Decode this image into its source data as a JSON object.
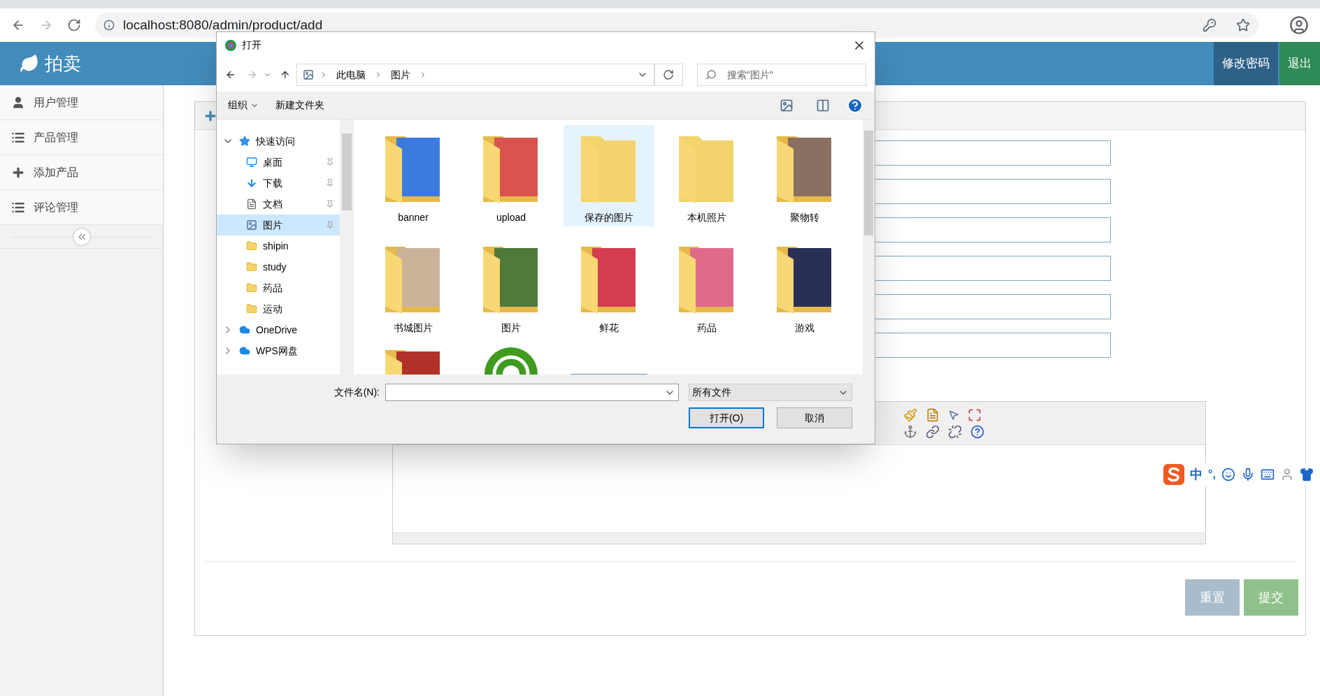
{
  "browser": {
    "url": "localhost:8080/admin/product/add"
  },
  "header": {
    "logo": "拍卖",
    "buttons": [
      {
        "label": "修改密码",
        "kind": "password"
      },
      {
        "label": "退出",
        "kind": "logout"
      }
    ]
  },
  "sidebar": {
    "items": [
      {
        "label": "用户管理",
        "kind": "user"
      },
      {
        "label": "产品管理",
        "kind": "list"
      },
      {
        "label": "添加产品",
        "kind": "plus"
      },
      {
        "label": "评论管理",
        "kind": "list"
      }
    ]
  },
  "form": {
    "buttons": [
      {
        "label": "重置",
        "kind": "reset"
      },
      {
        "label": "提交",
        "kind": "submit"
      }
    ]
  },
  "dialog": {
    "title": "打开",
    "breadcrumb": [
      "此电脑",
      "图片"
    ],
    "search": {
      "placeholder": "搜索\"图片\""
    },
    "toolbar": [
      "组织",
      "新建文件夹"
    ],
    "nav": [
      {
        "label": "快速访问",
        "kind": "star",
        "expanded": true,
        "children": [
          {
            "label": "桌面",
            "kind": "desktop",
            "pinned": true,
            "selected": false
          },
          {
            "label": "下载",
            "kind": "download",
            "pinned": true,
            "selected": false
          },
          {
            "label": "文档",
            "kind": "document",
            "pinned": true,
            "selected": false
          },
          {
            "label": "图片",
            "kind": "picture",
            "pinned": true,
            "selected": true
          },
          {
            "label": "shipin",
            "kind": "folder",
            "pinned": false,
            "selected": false
          },
          {
            "label": "study",
            "kind": "folder",
            "pinned": false,
            "selected": false
          },
          {
            "label": "药品",
            "kind": "folder",
            "pinned": false,
            "selected": false
          },
          {
            "label": "运动",
            "kind": "folder",
            "pinned": false,
            "selected": false
          }
        ]
      },
      {
        "label": "OneDrive",
        "kind": "cloud",
        "expanded": false
      },
      {
        "label": "WPS网盘",
        "kind": "cloud",
        "expanded": false
      }
    ],
    "folders": [
      {
        "label": "banner",
        "kind": "photos",
        "color": "#3b7be0",
        "selected": false
      },
      {
        "label": "upload",
        "kind": "photos",
        "color": "#d9534f",
        "selected": false
      },
      {
        "label": "保存的图片",
        "kind": "plain",
        "color": "#f3d36b",
        "selected": true
      },
      {
        "label": "本机照片",
        "kind": "plain",
        "color": "#f3d36b",
        "selected": false
      },
      {
        "label": "聚物转",
        "kind": "photos",
        "color": "#8a7060",
        "selected": false
      },
      {
        "label": "书城图片",
        "kind": "photos",
        "color": "#c9b49a",
        "selected": false
      },
      {
        "label": "图片",
        "kind": "photos",
        "color": "#4f7a3a",
        "selected": false
      },
      {
        "label": "鲜花",
        "kind": "photos",
        "color": "#d33d4f",
        "selected": false
      },
      {
        "label": "药品",
        "kind": "photos",
        "color": "#e06a8a",
        "selected": false
      },
      {
        "label": "游戏",
        "kind": "photos",
        "color": "#2a2f55",
        "selected": false
      }
    ],
    "partial_items": [
      {
        "kind": "photos",
        "color": "#b0302a"
      },
      {
        "kind": "app",
        "color": "#3f9a1f"
      },
      {
        "kind": "image",
        "color": "#6d8fb8"
      }
    ],
    "filename_label": "文件名(N):",
    "filetype": "所有文件",
    "buttons": [
      {
        "label": "打开(O)",
        "kind": "primary"
      },
      {
        "label": "取消",
        "kind": "secondary"
      }
    ]
  },
  "ime": {
    "mode": "中",
    "punct": "°,"
  }
}
